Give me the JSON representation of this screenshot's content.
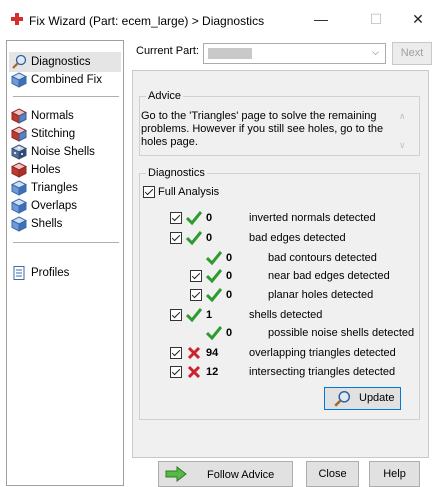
{
  "window": {
    "title": "Fix Wizard (Part: ecem_large) > Diagnostics",
    "minimize": "—",
    "maximize": "☐",
    "close": "✕"
  },
  "sidebar": {
    "items": [
      {
        "label": "Diagnostics",
        "icon": "magnifier-icon",
        "active": true
      },
      {
        "label": "Combined Fix",
        "icon": "cube-icon"
      },
      {
        "label": "Normals",
        "icon": "normals-cube-icon"
      },
      {
        "label": "Stitching",
        "icon": "stitching-cube-icon"
      },
      {
        "label": "Noise Shells",
        "icon": "noise-shells-icon"
      },
      {
        "label": "Holes",
        "icon": "holes-cube-icon"
      },
      {
        "label": "Triangles",
        "icon": "triangles-cube-icon"
      },
      {
        "label": "Overlaps",
        "icon": "overlaps-cube-icon"
      },
      {
        "label": "Shells",
        "icon": "shells-cube-icon"
      },
      {
        "label": "Profiles",
        "icon": "document-icon"
      }
    ]
  },
  "header": {
    "current_part_label": "Current Part:",
    "next_label": "Next"
  },
  "advice": {
    "title": "Advice",
    "text": "Go to the 'Triangles' page to solve the remaining problems. However if you still see holes, go to the holes page."
  },
  "diagnostics": {
    "title": "Diagnostics",
    "full_analysis_label": "Full Analysis",
    "rows": [
      {
        "checked": true,
        "status": "ok",
        "count": "0",
        "label": "inverted normals detected"
      },
      {
        "checked": true,
        "status": "ok",
        "count": "0",
        "label": "bad edges detected"
      },
      {
        "checked": false,
        "status": "ok",
        "count": "0",
        "label": "bad contours detected"
      },
      {
        "checked": true,
        "status": "ok",
        "count": "0",
        "label": "near bad edges detected"
      },
      {
        "checked": true,
        "status": "ok",
        "count": "0",
        "label": "planar holes detected"
      },
      {
        "checked": true,
        "status": "ok",
        "count": "1",
        "label": "shells detected"
      },
      {
        "checked": false,
        "status": "ok",
        "count": "0",
        "label": "possible noise shells detected"
      },
      {
        "checked": true,
        "status": "error",
        "count": "94",
        "label": "overlapping triangles detected"
      },
      {
        "checked": true,
        "status": "error",
        "count": "12",
        "label": "intersecting triangles detected"
      }
    ],
    "update_label": "Update"
  },
  "footer": {
    "follow_advice_label": "Follow Advice",
    "close_label": "Close",
    "help_label": "Help"
  },
  "colors": {
    "ok_check": "#2e9b2e",
    "error_x": "#d0202a",
    "title_icon": "#d32f2f"
  }
}
